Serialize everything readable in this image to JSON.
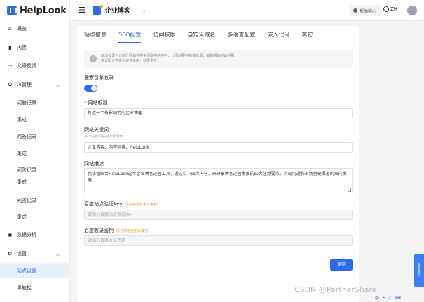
{
  "brand": {
    "name": "HelpLook"
  },
  "sidebar": {
    "items": [
      {
        "label": "概览",
        "icon": "home-icon"
      },
      {
        "label": "内容",
        "icon": "book-icon"
      },
      {
        "label": "文章反馈",
        "icon": "comment-icon"
      },
      {
        "label": "AI管理",
        "icon": "ai-icon"
      },
      {
        "label": "问答记录"
      },
      {
        "label": "集成"
      },
      {
        "label": "问答记录"
      },
      {
        "label": "集成"
      },
      {
        "label": "问答记录"
      },
      {
        "label": "集成"
      },
      {
        "label": "问答记录"
      },
      {
        "label": "集成"
      },
      {
        "label": "数据分析",
        "icon": "chart-icon"
      },
      {
        "label": "设置",
        "icon": "gear-icon"
      },
      {
        "label": "站点设置"
      },
      {
        "label": "导航栏"
      }
    ]
  },
  "topbar": {
    "site_name": "企业博客",
    "help_label": "帮助中心",
    "lang_label": "ZH"
  },
  "tabs": [
    "站点信息",
    "SEO配置",
    "访问权限",
    "自定义域名",
    "多语言配置",
    "嵌入代码",
    "其它"
  ],
  "notice": {
    "line1": "SEO设置可以提升网站在搜索引擎中的排名，让网站更好的被收录，提高网站的访问量。",
    "line2": "建议配合自定义域名使用，效果更佳。"
  },
  "form": {
    "search_indexing_label": "搜索引擎收录",
    "site_title_label": "网站标题",
    "site_title_value": "打造一个有影响力的企业博客",
    "keywords_label": "网站关键词",
    "keywords_hint": "多个关键词请用逗号隔开",
    "keywords_value": "企业博客、内容运营、HelpLook",
    "description_label": "网站描述",
    "description_value": "我该管结合HelpLook这个企业博客运营工具，通过以下四点内容，来分享博客运营发展的四大注意要点，实现沟通和市场营销渠道的双向发展。",
    "baidu_key_label": "百度站点验证Key",
    "baidu_key_warn": "请先绑定自定义域名!",
    "baidu_key_placeholder": "请输入百度站点验证Key",
    "baidu_secret_label": "百度收录密钥",
    "baidu_secret_warn": "请先绑定自定义域名!",
    "baidu_secret_placeholder": "请输入百度收录密钥",
    "save_label": "保存"
  },
  "widgets": {
    "side_tab": "联系我们",
    "watermark": "CSDN @PartnerShare",
    "ime_label": "中"
  },
  "colors": {
    "accent": "#2c6bf0",
    "warn": "#f0932b",
    "required": "#e54545"
  }
}
